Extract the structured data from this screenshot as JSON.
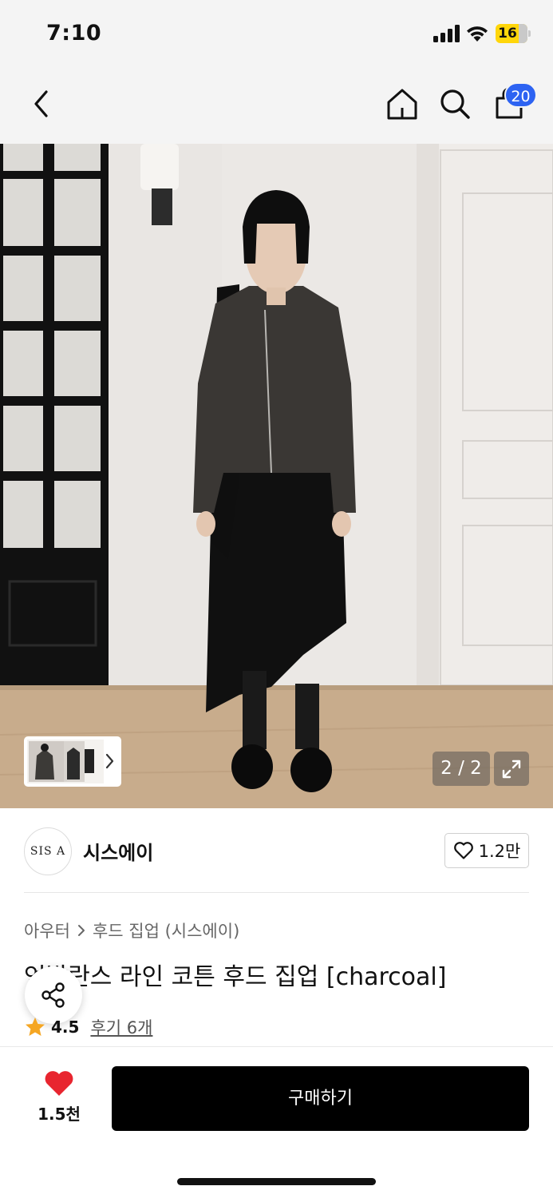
{
  "status_bar": {
    "time": "7:10",
    "battery": "16"
  },
  "nav": {
    "cart_count": "20"
  },
  "gallery": {
    "page_indicator": "2 / 2",
    "current_page": 2,
    "total_pages": 2
  },
  "brand": {
    "logo_text": "SIS A",
    "name": "시스에이",
    "like_count": "1.2만"
  },
  "breadcrumb": {
    "category": "아우터",
    "subcategory": "후드 집업 (시스에이)"
  },
  "product": {
    "title": "언발란스 라인 코튼 후드 집업 [charcoal]",
    "rating": "4.5",
    "reviews_label": "후기 6개"
  },
  "bottom_bar": {
    "wish_count": "1.5천",
    "buy_label": "구매하기"
  },
  "colors": {
    "accent_blue": "#2d63f2",
    "heart_red": "#e8252f",
    "star_orange": "#f5a623",
    "buy_black": "#000000"
  }
}
